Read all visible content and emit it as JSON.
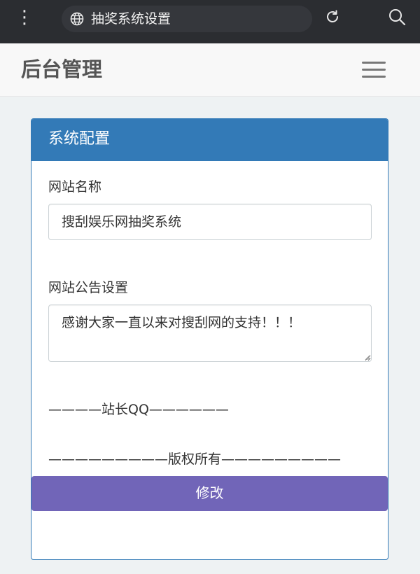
{
  "browser": {
    "url_title": "抽奖系统设置",
    "icons": [
      "menu-dots-icon",
      "globe-icon",
      "reload-icon",
      "search-icon"
    ]
  },
  "header": {
    "brand": "后台管理",
    "menu_icon": "hamburger-icon"
  },
  "panel": {
    "title": "系统配置",
    "site_name_label": "网站名称",
    "site_name_value": "搜刮娱乐网抽奖系统",
    "notice_label": "网站公告设置",
    "notice_value": "感谢大家一直以来对搜刮网的支持！！！",
    "contact_line": "————站长QQ——————",
    "copyright_line": "—————————版权所有—————————",
    "submit_label": "修改"
  },
  "colors": {
    "browser_bar": "#2b2d31",
    "panel_primary": "#337ab7",
    "submit_button": "#7165b8",
    "page_background": "#eef2f3"
  }
}
